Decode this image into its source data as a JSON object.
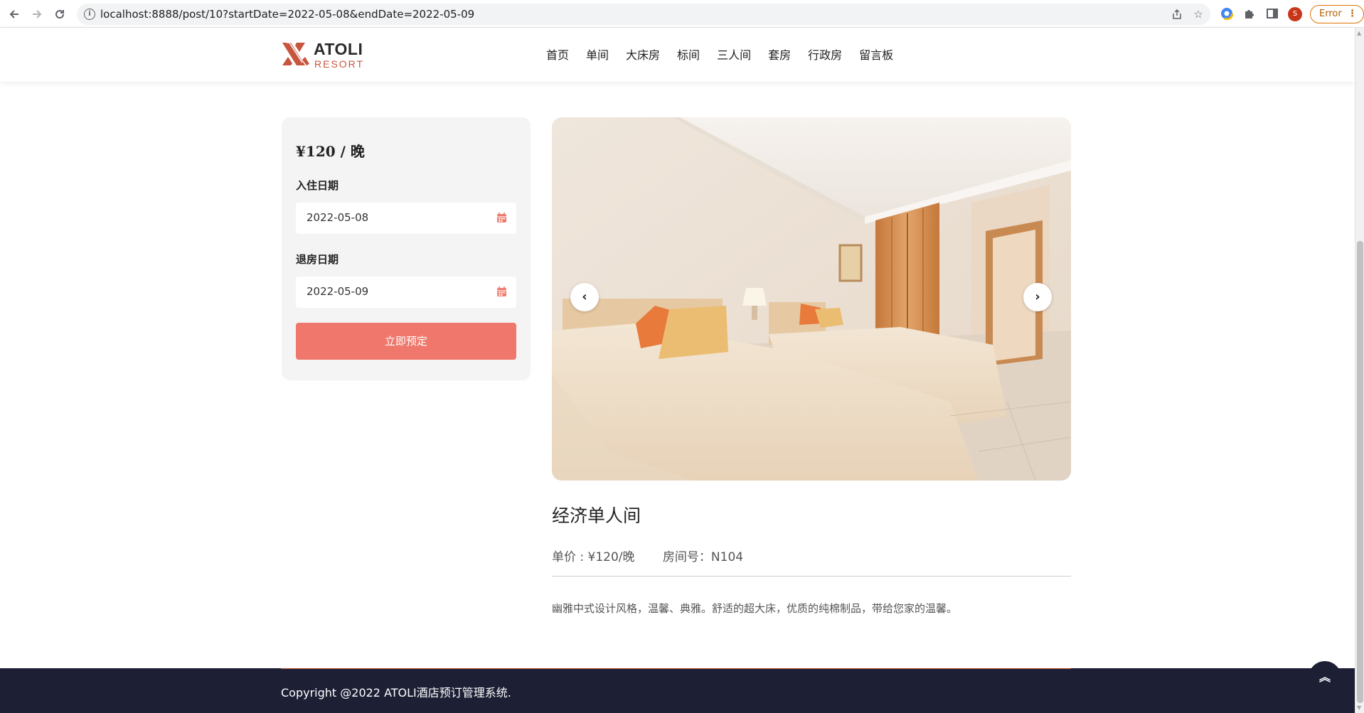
{
  "browser": {
    "url": "localhost:8888/post/10?startDate=2022-05-08&endDate=2022-05-09",
    "profile_initial": "S",
    "error_label": "Error"
  },
  "site": {
    "logo_title": "ATOLI",
    "logo_sub": "RESORT",
    "nav": [
      "首页",
      "单间",
      "大床房",
      "标间",
      "三人间",
      "套房",
      "行政房",
      "留言板"
    ]
  },
  "booking": {
    "price": "¥120 / 晚",
    "checkin_label": "入住日期",
    "checkin_value": "2022-05-08",
    "checkout_label": "退房日期",
    "checkout_value": "2022-05-09",
    "book_button": "立即预定"
  },
  "room": {
    "title": "经济单人间",
    "unit_price": "单价 : ¥120/晚",
    "room_number": "房间号：N104",
    "description": "幽雅中式设计风格，温馨、典雅。舒适的超大床，优质的纯棉制品，带给您家的温馨。"
  },
  "footer": {
    "copyright": "Copyright @2022 ATOLI酒店预订管理系统."
  },
  "colors": {
    "accent": "#ef776b",
    "footer_bg": "#1d1f35",
    "card_bg": "#f4f4f4"
  }
}
